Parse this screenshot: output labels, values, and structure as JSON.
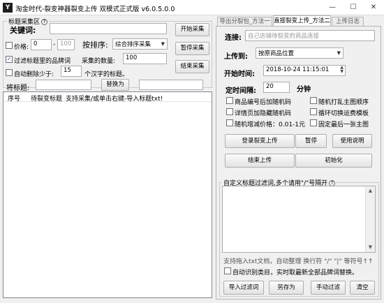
{
  "window": {
    "title": "淘金时代-裂变神器裂变上传 双模式正式版 v6.0.5.0.0",
    "app_icon_letter": "Y",
    "min_glyph": "—",
    "max_glyph": "☐",
    "close_glyph": "✕"
  },
  "left": {
    "group_title": "标题采集区",
    "help_glyph": "?",
    "keyword_label": "关键词:",
    "keyword_value": "",
    "price_label": "价格:",
    "price_min": "0",
    "price_dash": "-",
    "price_max": "100",
    "sort_label": "按排序:",
    "sort_value": "综合排序采集",
    "filter_brand_label": "过滤标题里的品牌词",
    "collect_count_label": "采集的数量:",
    "collect_count_value": "100",
    "auto_delete_label": "自动删除少于:",
    "auto_delete_value": "15",
    "auto_delete_suffix": "个汉字的标题。",
    "title_label": "将标题:",
    "title_value": "",
    "replace_button": "替换为",
    "replace_value": "",
    "start_button": "开始采集",
    "pause_button": "暂停采集",
    "end_button": "结束采集",
    "table": {
      "col_no": "序号",
      "col_title": "待裂变标题",
      "col_hint": "支持采集/或单击右键-导入标题txt!"
    }
  },
  "right": {
    "tabs": [
      "导出分裂包_方法一",
      "直接裂变上传_方法二",
      "上传日志"
    ],
    "link_label": "连接:",
    "link_placeholder": "自己店铺待裂变的商品连接",
    "upload_to_label": "上传到:",
    "upload_to_value": "按原商品位置",
    "start_time_label": "开始时间:",
    "start_time_value": "2018-10-24 11:15:01",
    "interval_label": "定时间隔:",
    "interval_value": "20",
    "interval_unit": "分钟",
    "options": [
      {
        "label": "商品编号后加随机码",
        "checked": false
      },
      {
        "label": "随机打乱主图顺序",
        "checked": false
      },
      {
        "label": "详情页加隐藏随机码",
        "checked": false
      },
      {
        "label": "循环切换运费模板",
        "checked": false
      },
      {
        "label": "随机增减价格：0.01-1元",
        "checked": false
      },
      {
        "label": "固定最后一张主图",
        "checked": false
      }
    ],
    "login_upload_button": "登录裂变上传",
    "pause_button": "暂停",
    "help_button": "使用说明",
    "end_upload_button": "结束上传",
    "init_button": "初始化",
    "filter_group_title": "自定义标题过滤词,多个请用\"/\"号隔开",
    "filter_help_glyph": "?",
    "filter_hint": "支持拖入txt文档，自动整理 换行符 \"/\" \"|\" 等符号↑↑",
    "auto_brand_label": "自动识别类目，实时取最新全部品牌词替换。",
    "import_button": "导入过滤词",
    "save_button": "另存为",
    "manual_button": "手动过滤",
    "clear_button": "清空"
  }
}
